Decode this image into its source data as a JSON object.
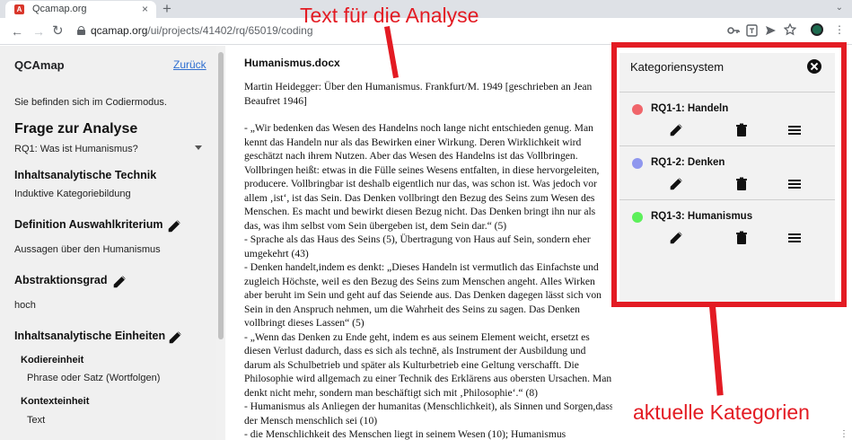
{
  "browser": {
    "tab_title": "Qcamap.org",
    "tab_close": "×",
    "new_tab": "+",
    "favicon_letter": "A",
    "url_host": "qcamap.org",
    "url_path": "/ui/projects/41402/rq/65019/coding"
  },
  "sidebar": {
    "brand": "QCAmap",
    "back_link": "Zurück",
    "mode_text": "Sie befinden sich im Codiermodus.",
    "question_heading": "Frage zur Analyse",
    "research_question": "RQ1: Was ist Humanismus?",
    "technique_heading": "Inhaltsanalytische Technik",
    "technique_value": "Induktive Kategoriebildung",
    "criterion_heading": "Definition Auswahlkriterium",
    "criterion_value": "Aussagen über den Humanismus",
    "abstraction_heading": "Abstraktionsgrad",
    "abstraction_value": "hoch",
    "units_heading": "Inhaltsanalytische Einheiten",
    "coding_unit_label": "Kodiereinheit",
    "coding_unit_value": "Phrase oder Satz (Wortfolgen)",
    "context_unit_label": "Kontexteinheit",
    "context_unit_value": "Text"
  },
  "document": {
    "title": "Humanismus.docx",
    "paragraphs": [
      "Martin Heidegger: Über den Humanismus. Frankfurt/M. 1949 [geschrieben an Jean Beaufret 1946]",
      "- „Wir bedenken das Wesen des Handelns noch lange nicht entschieden genug. Man kennt das Handeln nur als das Bewirken einer Wirkung. Deren Wirklichkeit wird geschätzt nach ihrem Nutzen. Aber das Wesen des Handelns ist das Vollbringen. Vollbringen heißt: etwas in die Fülle seines Wesens entfalten, in diese hervorgeleiten, producere. Vollbringbar ist deshalb eigentlich nur das, was schon ist. Was jedoch vor allem ‚ist‘, ist das Sein. Das Denken vollbringt den Bezug des Seins zum Wesen des Menschen. Es macht und bewirkt diesen Bezug nicht. Das Denken bringt ihn nur als das, was ihm selbst vom Sein übergeben ist, dem Sein dar.“ (5)",
      "- Sprache als das Haus des Seins (5),  Übertragung von Haus auf Sein, sondern eher umgekehrt (43)",
      "- Denken handelt,indem es denkt: „Dieses Handeln ist vermutlich das Einfachste und zugleich Höchste, weil es den Bezug des Seins zum Menschen angeht. Alles Wirken aber beruht im Sein und geht auf das Seiende aus. Das Denken dagegen lässt sich von Sein in den Anspruch nehmen, um die Wahrheit des Seins zu sagen. Das Denken vollbringt dieses Lassen“ (5)",
      "- „Wenn das Denken zu Ende geht, indem es aus seinem Element weicht, ersetzt es diesen Verlust dadurch, dass es sich als technē, als Instrument der Ausbildung und darum als Schulbetrieb und später als Kulturbetrieb eine Geltung verschafft. Die Philosophie wird allgemach zu einer Technik des Erklärens aus obersten Ursachen. Man denkt nicht mehr, sondern man beschäftigt sich mit ‚Philosophie‘.“ (8)",
      "- Humanismus als Anliegen der humanitas (Menschlichkeit), als Sinnen und Sorgen,dass der Mensch menschlich sei (10)",
      "- die Menschlichkeit des Menschen liegt in seinem Wesen (10); Humanismus"
    ]
  },
  "category_panel": {
    "title": "Kategoriensystem",
    "categories": [
      {
        "label": "RQ1-1: Handeln",
        "color": "#f0656a"
      },
      {
        "label": "RQ1-2: Denken",
        "color": "#8f97ee"
      },
      {
        "label": "RQ1-3: Humanismus",
        "color": "#5cf05a"
      }
    ]
  },
  "annotations": {
    "top_label": "Text für die Analyse",
    "bottom_label": "aktuelle Kategorien",
    "color": "#e31b23"
  },
  "icons": {
    "edit": "pencil-icon",
    "delete": "trash-icon",
    "reorder": "menu-icon",
    "close": "close-circle-icon"
  }
}
